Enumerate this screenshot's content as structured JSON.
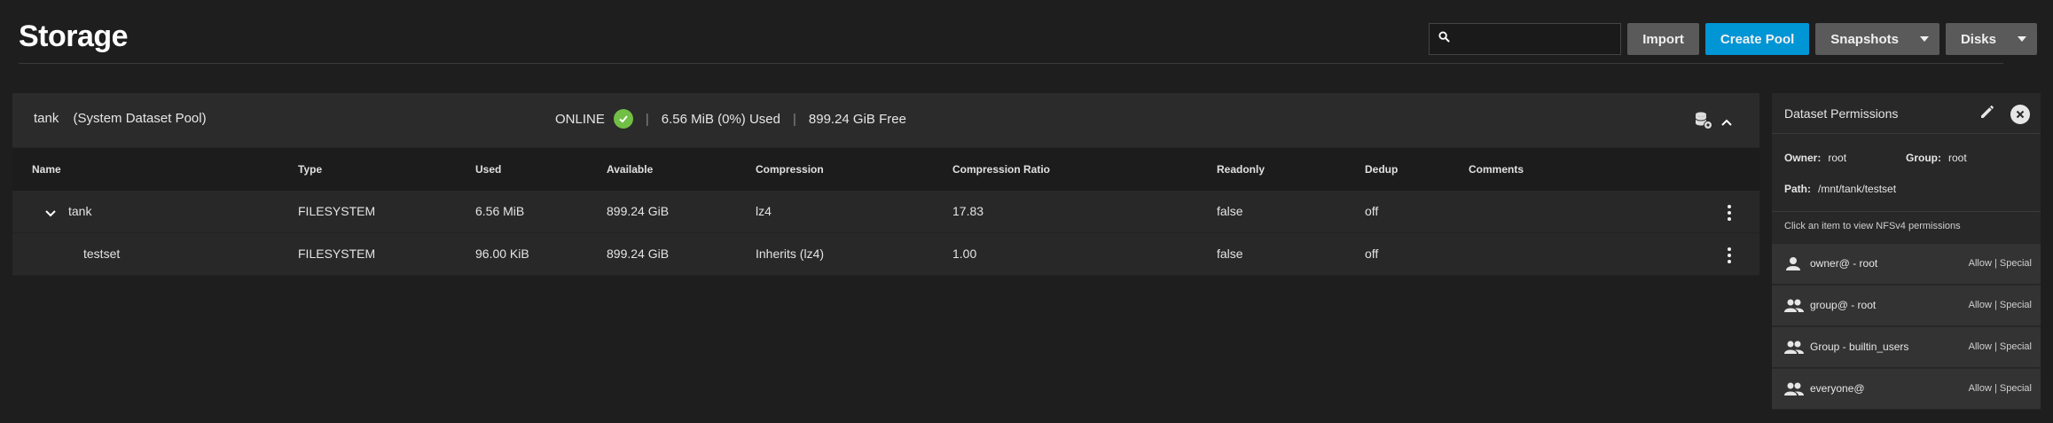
{
  "page": {
    "title": "Storage"
  },
  "toolbar": {
    "search_placeholder": "",
    "import_label": "Import",
    "create_pool_label": "Create Pool",
    "snapshots_label": "Snapshots",
    "disks_label": "Disks"
  },
  "pool": {
    "name": "tank",
    "subtitle": "(System Dataset Pool)",
    "status": "ONLINE",
    "used": "6.56 MiB (0%) Used",
    "free": "899.24 GiB Free",
    "separator": "|"
  },
  "table": {
    "headers": [
      "Name",
      "Type",
      "Used",
      "Available",
      "Compression",
      "Compression Ratio",
      "Readonly",
      "Dedup",
      "Comments"
    ],
    "rows": [
      {
        "name": "tank",
        "type": "FILESYSTEM",
        "used": "6.56 MiB",
        "available": "899.24 GiB",
        "compression": "lz4",
        "ratio": "17.83",
        "readonly": "false",
        "dedup": "off",
        "comments": ""
      },
      {
        "name": "testset",
        "type": "FILESYSTEM",
        "used": "96.00 KiB",
        "available": "899.24 GiB",
        "compression": "Inherits (lz4)",
        "ratio": "1.00",
        "readonly": "false",
        "dedup": "off",
        "comments": ""
      }
    ]
  },
  "permissions": {
    "title": "Dataset Permissions",
    "owner_label": "Owner:",
    "owner_value": "root",
    "group_label": "Group:",
    "group_value": "root",
    "path_label": "Path:",
    "path_value": "/mnt/tank/testset",
    "hint": "Click an item to view NFSv4 permissions",
    "items": [
      {
        "label": "owner@ - root",
        "value": "Allow | Special",
        "icon": "person-icon"
      },
      {
        "label": "group@ - root",
        "value": "Allow | Special",
        "icon": "group-icon"
      },
      {
        "label": "Group - builtin_users",
        "value": "Allow | Special",
        "icon": "group-icon"
      },
      {
        "label": "everyone@",
        "value": "Allow | Special",
        "icon": "group-icon"
      }
    ]
  },
  "colors": {
    "accent": "#0095d5",
    "status_ok": "#71bf44",
    "background": "#1e1e1e"
  }
}
